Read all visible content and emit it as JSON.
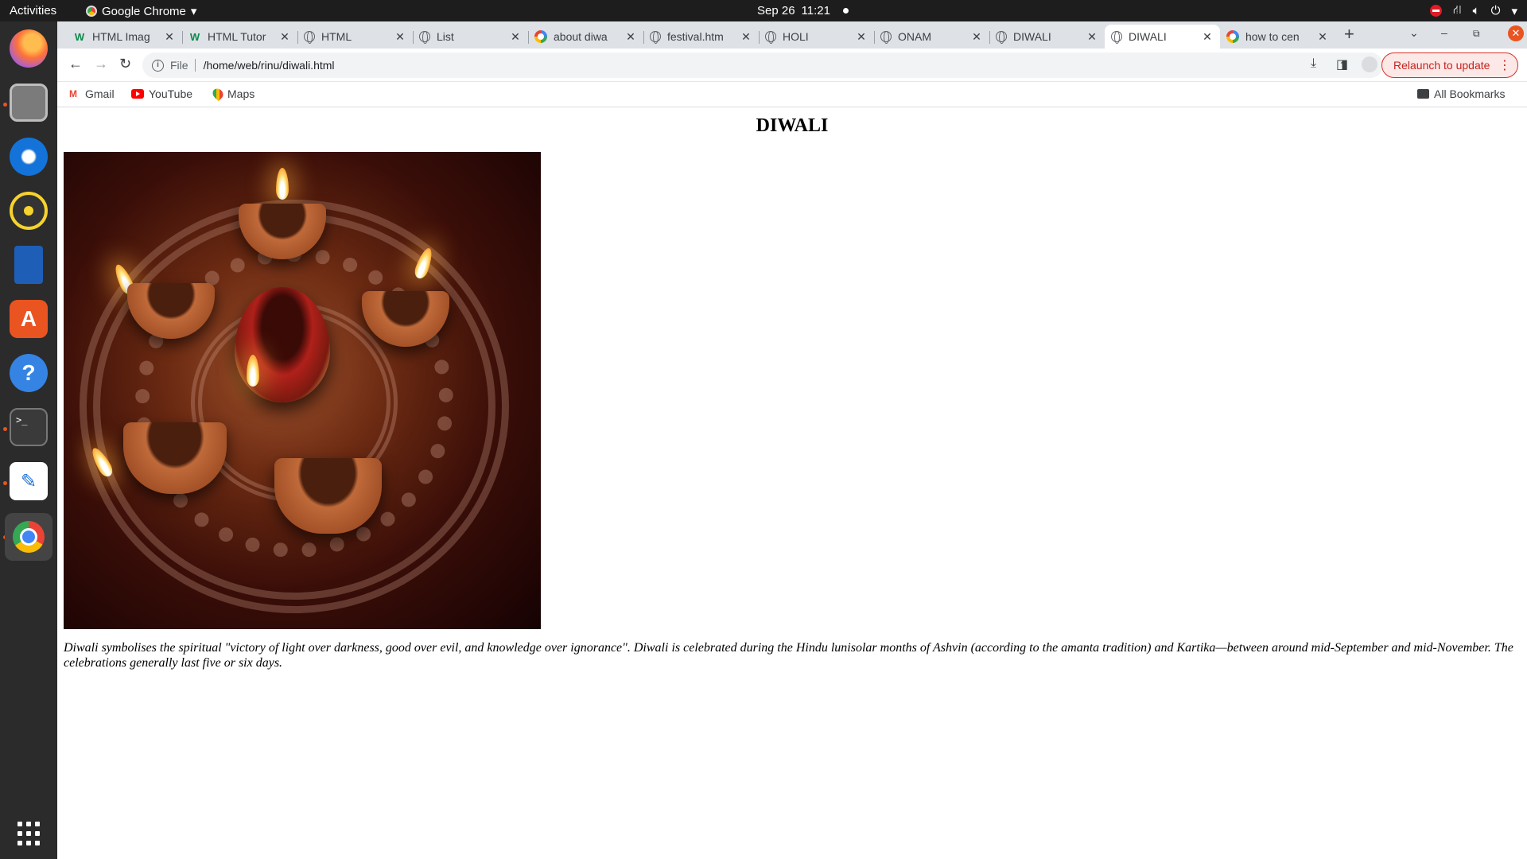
{
  "topbar": {
    "activities": "Activities",
    "app_menu": "Google Chrome",
    "date": "Sep 26",
    "time": "11:21"
  },
  "dock": {
    "apps": [
      "firefox-icon",
      "files-icon",
      "thunderbird-icon",
      "rhythmbox-icon",
      "writer-icon",
      "app-center-icon",
      "help-icon",
      "terminal-icon",
      "text-editor-icon",
      "chrome-icon",
      "show-apps-icon"
    ]
  },
  "tabs": [
    {
      "title": "HTML Imag",
      "icon": "w3schools-icon"
    },
    {
      "title": "HTML Tutor",
      "icon": "w3schools-icon"
    },
    {
      "title": "HTML",
      "icon": "globe-icon"
    },
    {
      "title": "List",
      "icon": "globe-icon"
    },
    {
      "title": "about diwa",
      "icon": "google-icon"
    },
    {
      "title": "festival.htm",
      "icon": "globe-icon"
    },
    {
      "title": "HOLI",
      "icon": "globe-icon"
    },
    {
      "title": "ONAM",
      "icon": "globe-icon"
    },
    {
      "title": "DIWALI",
      "icon": "globe-icon"
    },
    {
      "title": "DIWALI",
      "icon": "globe-icon",
      "active": true
    },
    {
      "title": "how to cen",
      "icon": "google-icon"
    }
  ],
  "omnibox": {
    "scheme": "File",
    "url": "/home/web/rinu/diwali.html"
  },
  "toolbar": {
    "relaunch_label": "Relaunch to update"
  },
  "bookmarks": {
    "items": [
      "Gmail",
      "YouTube",
      "Maps"
    ],
    "all": "All Bookmarks"
  },
  "page": {
    "heading": "DIWALI",
    "paragraph": "Diwali symbolises the spiritual \"victory of light over darkness, good over evil, and knowledge over ignorance\". Diwali is celebrated during the Hindu lunisolar months of Ashvin (according to the amanta tradition) and Kartika—between around mid-September and mid-November. The celebrations generally last five or six days."
  },
  "colors": {
    "accent": "#e95420",
    "relaunch": "#d93025"
  }
}
